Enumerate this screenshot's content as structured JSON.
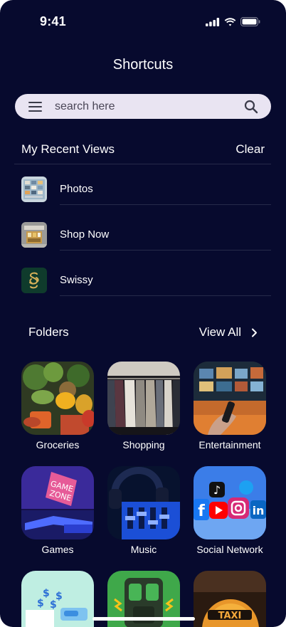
{
  "status_bar": {
    "time": "9:41"
  },
  "page": {
    "title": "Shortcuts"
  },
  "search": {
    "placeholder": "search here"
  },
  "recent": {
    "title": "My Recent Views",
    "clear_label": "Clear",
    "items": [
      {
        "label": "Photos"
      },
      {
        "label": "Shop Now"
      },
      {
        "label": "Swissy"
      }
    ]
  },
  "folders": {
    "title": "Folders",
    "view_all_label": "View All",
    "items": [
      {
        "label": "Groceries"
      },
      {
        "label": "Shopping"
      },
      {
        "label": "Entertainment"
      },
      {
        "label": "Games"
      },
      {
        "label": "Music"
      },
      {
        "label": "Social Network"
      }
    ]
  },
  "colors": {
    "background": "#070a2e",
    "search_background": "#e9e4f2",
    "divider": "#262a4a"
  }
}
